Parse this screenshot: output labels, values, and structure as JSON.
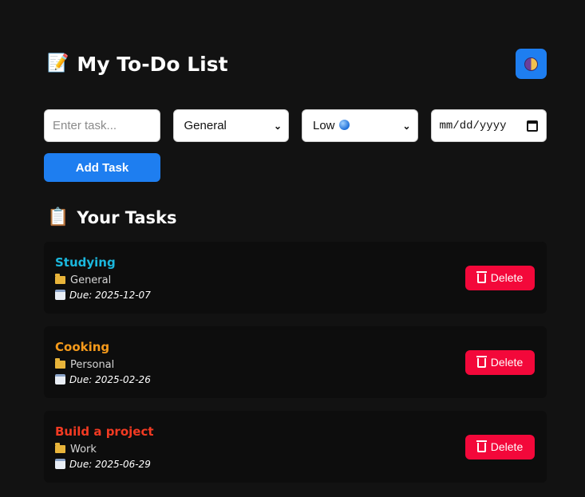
{
  "header": {
    "title_emoji": "📝",
    "title": "My To-Do List",
    "theme_toggle_icon": "half-moon-icon"
  },
  "form": {
    "task_placeholder": "Enter task...",
    "category_selected": "General",
    "priority_selected": "Low",
    "date_placeholder": "mm/dd/yyyy",
    "add_button": "Add Task"
  },
  "tasks_section": {
    "emoji": "📋",
    "title": "Your Tasks"
  },
  "tasks": [
    {
      "name": "Studying",
      "category": "General",
      "due": "Due: 2025-12-07",
      "color": "#1bb8de",
      "delete_label": "Delete"
    },
    {
      "name": "Cooking",
      "category": "Personal",
      "due": "Due: 2025-02-26",
      "color": "#f59a1b",
      "delete_label": "Delete"
    },
    {
      "name": "Build a project",
      "category": "Work",
      "due": "Due: 2025-06-29",
      "color": "#f23a22",
      "delete_label": "Delete"
    }
  ],
  "colors": {
    "background": "#121212",
    "card": "#0d0d0d",
    "accent": "#1e7ef0",
    "danger": "#f3083a"
  }
}
